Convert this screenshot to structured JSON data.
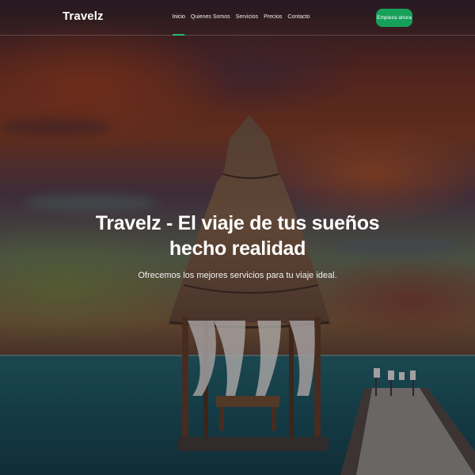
{
  "header": {
    "brand": "Travelz",
    "nav": [
      {
        "label": "Inicio",
        "active": true
      },
      {
        "label": "Quienes Somos",
        "active": false
      },
      {
        "label": "Servicios",
        "active": false
      },
      {
        "label": "Precios",
        "active": false
      },
      {
        "label": "Contacto",
        "active": false
      }
    ],
    "cta_label": "Empieza ahora"
  },
  "hero": {
    "title": "Travelz - El viaje de tus sueños hecho realidad",
    "subtitle": "Ofrecemos los mejores servicios para tu viaje ideal."
  },
  "background": {
    "image": "thatched-hut-over-sea-at-sunset"
  },
  "colors": {
    "accent": "#17a05a",
    "active_underline": "#1cbf6b",
    "text": "#ffffff"
  }
}
